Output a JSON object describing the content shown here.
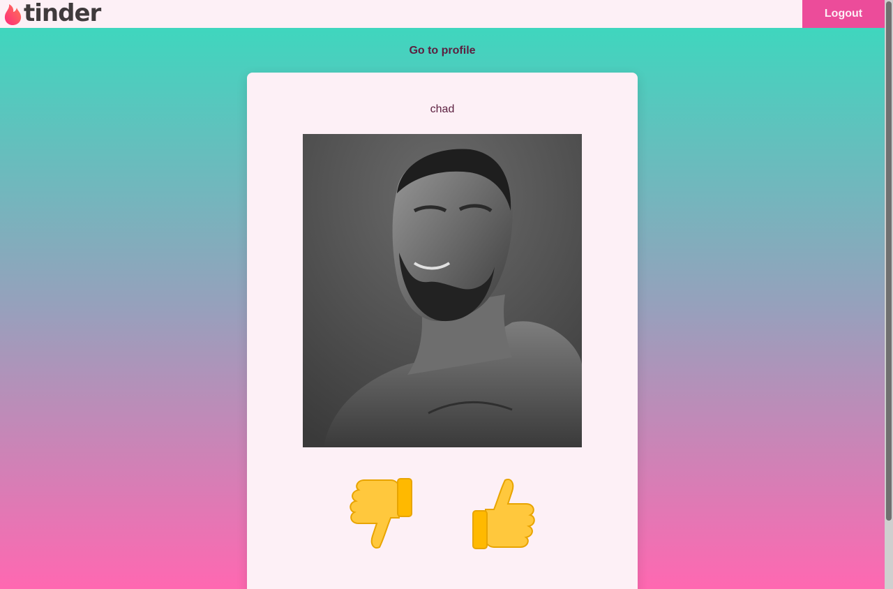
{
  "header": {
    "logo_text": "tinder",
    "logout_label": "Logout"
  },
  "main": {
    "profile_link": "Go to profile",
    "card": {
      "name": "chad",
      "photo": "profile-photo",
      "dislike_icon": "thumbs-down-icon",
      "like_icon": "thumbs-up-icon"
    }
  },
  "colors": {
    "brand_pink": "#ec4c9a",
    "gradient_top": "#3fd6be",
    "gradient_bottom": "#ff68b1",
    "card_bg": "#fdf0f6",
    "text_dark": "#5c2040"
  }
}
